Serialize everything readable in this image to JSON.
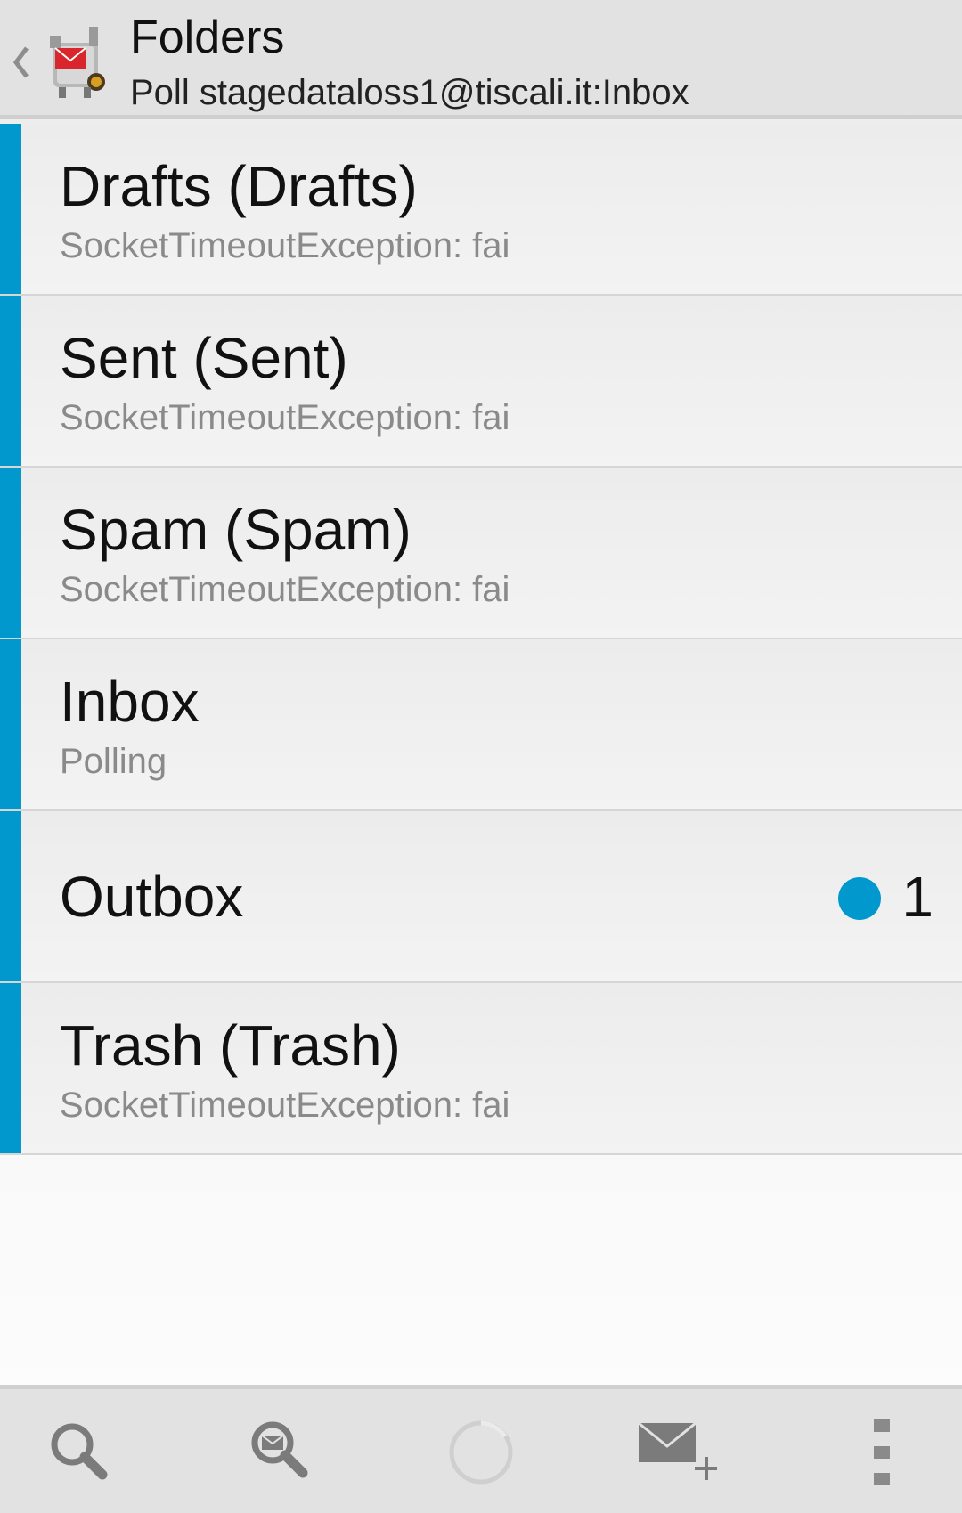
{
  "header": {
    "title": "Folders",
    "subtitle": "Poll stagedataloss1@tiscali.it:Inbox",
    "back_icon": "chevron-left-icon",
    "app_icon": "k9-mail-robot-icon"
  },
  "colors": {
    "accent": "#0098cd",
    "header_bg": "#e2e2e2",
    "status_text": "#8a8a8a"
  },
  "folders": [
    {
      "name": "Drafts (Drafts)",
      "status": "SocketTimeoutException: fai"
    },
    {
      "name": "Sent (Sent)",
      "status": "SocketTimeoutException: fai"
    },
    {
      "name": "Spam (Spam)",
      "status": "SocketTimeoutException: fai"
    },
    {
      "name": "Inbox",
      "status": "Polling"
    },
    {
      "name": "Outbox",
      "unread_count": "1"
    },
    {
      "name": "Trash (Trash)",
      "status": "SocketTimeoutException: fai"
    }
  ],
  "bottom_bar": {
    "icons": [
      "search-icon",
      "search-messages-icon",
      "loading-spinner-icon",
      "compose-mail-icon",
      "overflow-menu-icon"
    ]
  }
}
